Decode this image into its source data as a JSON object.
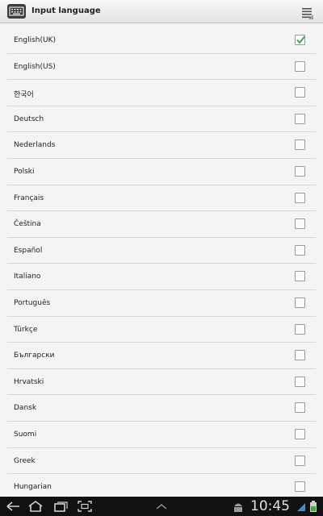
{
  "header": {
    "title": "Input language"
  },
  "languages": [
    {
      "label": "English(UK)",
      "checked": true
    },
    {
      "label": "English(US)",
      "checked": false
    },
    {
      "label": "한국어",
      "checked": false
    },
    {
      "label": "Deutsch",
      "checked": false
    },
    {
      "label": "Nederlands",
      "checked": false
    },
    {
      "label": "Polski",
      "checked": false
    },
    {
      "label": "Français",
      "checked": false
    },
    {
      "label": "Čeština",
      "checked": false
    },
    {
      "label": "Español",
      "checked": false
    },
    {
      "label": "Italiano",
      "checked": false
    },
    {
      "label": "Português",
      "checked": false
    },
    {
      "label": "Türkçe",
      "checked": false
    },
    {
      "label": "Български",
      "checked": false
    },
    {
      "label": "Hrvatski",
      "checked": false
    },
    {
      "label": "Dansk",
      "checked": false
    },
    {
      "label": "Suomi",
      "checked": false
    },
    {
      "label": "Greek",
      "checked": false
    },
    {
      "label": "Hungarian",
      "checked": false
    }
  ],
  "status_bar": {
    "time": "10:45"
  },
  "colors": {
    "check": "#3cb043",
    "nav_background": "#111111"
  }
}
